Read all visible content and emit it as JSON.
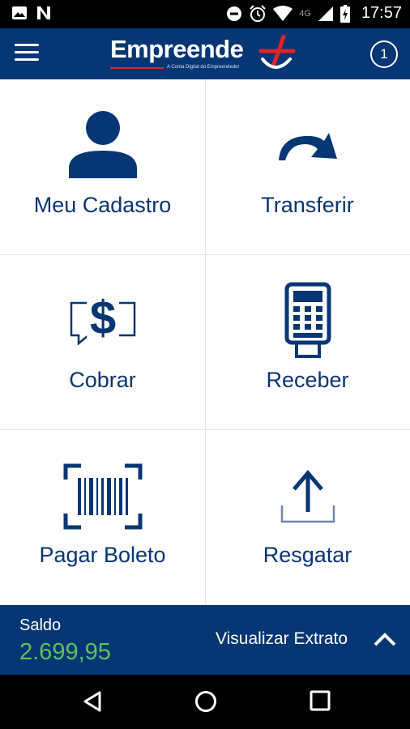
{
  "status_bar": {
    "network": "4G",
    "time": "17:57"
  },
  "app_bar": {
    "logo_text": "Empreende",
    "logo_tagline": "A Conta Digital do Empreendedor",
    "notification_count": "1"
  },
  "tiles": [
    {
      "label": "Meu Cadastro",
      "icon": "user-icon"
    },
    {
      "label": "Transferir",
      "icon": "transfer-arrow-icon"
    },
    {
      "label": "Cobrar",
      "icon": "dollar-chat-icon"
    },
    {
      "label": "Receber",
      "icon": "card-machine-icon"
    },
    {
      "label": "Pagar Boleto",
      "icon": "barcode-icon"
    },
    {
      "label": "Resgatar",
      "icon": "upload-icon"
    }
  ],
  "balance": {
    "label": "Saldo",
    "value": "2.699,95",
    "extrato_label": "Visualizar Extrato"
  },
  "colors": {
    "brand_blue": "#073674",
    "balance_green": "#5ac35a",
    "accent_red": "#e0232b"
  }
}
